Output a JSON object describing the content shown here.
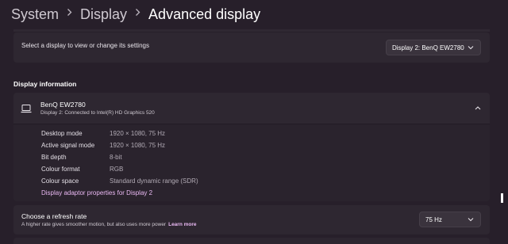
{
  "breadcrumb": {
    "items": [
      "System",
      "Display",
      "Advanced display"
    ]
  },
  "display_select": {
    "label": "Select a display to view or change its settings",
    "value": "Display 2: BenQ EW2780"
  },
  "display_info": {
    "section_title": "Display information",
    "monitor_name": "BenQ EW2780",
    "monitor_subtitle": "Display 2: Connected to Intel(R) HD Graphics 520",
    "rows": [
      {
        "key": "Desktop mode",
        "value": "1920 × 1080, 75 Hz"
      },
      {
        "key": "Active signal mode",
        "value": "1920 × 1080, 75 Hz"
      },
      {
        "key": "Bit depth",
        "value": "8-bit"
      },
      {
        "key": "Colour format",
        "value": "RGB"
      },
      {
        "key": "Colour space",
        "value": "Standard dynamic range (SDR)"
      }
    ],
    "adapter_link": "Display adaptor properties for Display 2"
  },
  "refresh_rate": {
    "title": "Choose a refresh rate",
    "subtitle": "A higher rate gives smoother motion, but also uses more power",
    "learn_more": "Learn more",
    "value": "75 Hz"
  },
  "icons": {
    "breadcrumb_separator": "chevron-right-icon",
    "dropdown": "chevron-down-icon",
    "collapse": "chevron-up-icon",
    "monitor": "laptop-icon"
  },
  "colors": {
    "background": "#271f2a",
    "card": "#2e2731",
    "accent": "#e9b8f2"
  }
}
